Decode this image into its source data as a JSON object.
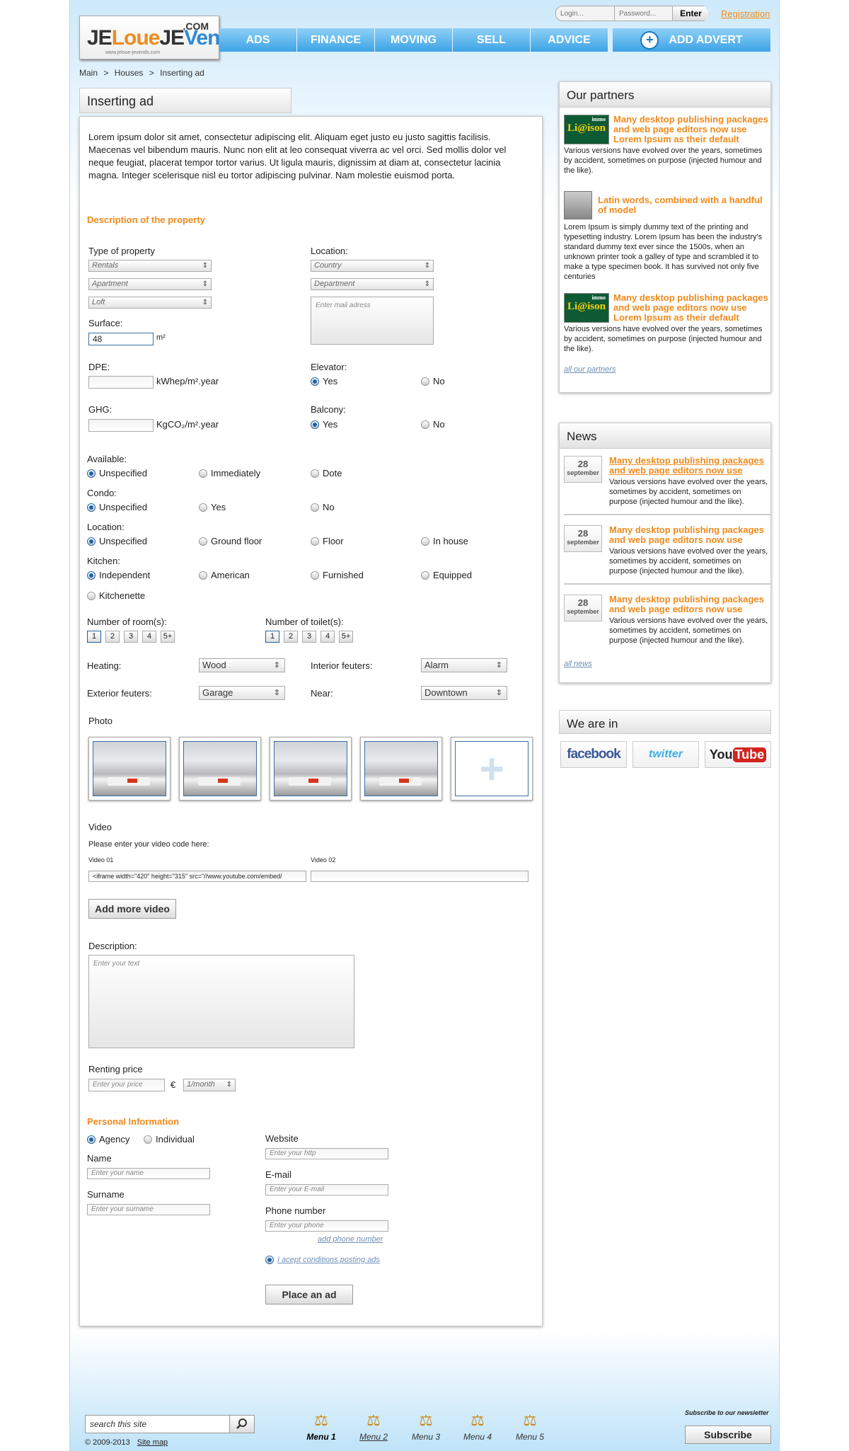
{
  "header": {
    "logo": {
      "part1": "JE",
      "part2": "Loue",
      "part3": "JE",
      "part4": "Vends",
      "com": ".COM",
      "url": "www.jeloue-jevends.com"
    },
    "login_placeholder": "Login...",
    "password_placeholder": "Password...",
    "enter_label": "Enter",
    "registration_label": "Registration",
    "nav": [
      "ADS",
      "FINANCE",
      "MOVING",
      "SELL",
      "ADVICE"
    ],
    "add_advert_label": "ADD ADVERT",
    "breadcrumb": [
      "Main",
      "Houses",
      "Inserting ad"
    ],
    "breadcrumb_sep": ">"
  },
  "main": {
    "title": "Inserting ad",
    "intro": "Lorem ipsum dolor sit amet, consectetur adipiscing elit. Aliquam eget justo eu justo sagittis facilisis. Maecenas vel bibendum mauris. Nunc non elit at leo consequat viverra ac vel orci. Sed mollis dolor vel neque feugiat, placerat tempor tortor varius. Ut ligula mauris, dignissim at diam at, consectetur lacinia magna. Integer scelerisque nisl eu tortor adipiscing pulvinar. Nam molestie euismod porta.",
    "description_title": "Description of the property",
    "type_label": "Type of property",
    "type_selects": [
      "Rentals",
      "Apartment",
      "Loft"
    ],
    "location_label": "Location:",
    "location_selects": [
      "Country",
      "Department"
    ],
    "mail_placeholder": "Enter mail adress",
    "surface_label": "Surface:",
    "surface_value": "48",
    "surface_unit": "m²",
    "dpe_label": "DPE:",
    "dpe_unit": "kWhep/m².year",
    "ghg_label": "GHG:",
    "ghg_unit": "KgCO₂/m².year",
    "elevator_label": "Elevator:",
    "balcony_label": "Balcony:",
    "yes": "Yes",
    "no": "No",
    "available_label": "Available:",
    "available_opts": [
      "Unspecified",
      "Immediately",
      "Dote"
    ],
    "condo_label": "Condo:",
    "condo_opts": [
      "Unspecified",
      "Yes",
      "No"
    ],
    "location2_label": "Location:",
    "location2_opts": [
      "Unspecified",
      "Ground floor",
      "Floor",
      "In house"
    ],
    "kitchen_label": "Kitchen:",
    "kitchen_opts": [
      "Independent",
      "American",
      "Furnished",
      "Equipped",
      "Kitchenette"
    ],
    "rooms_label": "Number of room(s):",
    "toilets_label": "Number of toilet(s):",
    "num_opts": [
      "1",
      "2",
      "3",
      "4",
      "5+"
    ],
    "heating_label": "Heating:",
    "heating_value": "Wood",
    "interior_label": "Interior feuters:",
    "interior_value": "Alarm",
    "exterior_label": "Exterior feuters:",
    "exterior_value": "Garage",
    "near_label": "Near:",
    "near_value": "Downtown",
    "photo_label": "Photo",
    "add_photo_symbol": "+",
    "video_label": "Video",
    "video_hint": "Please enter your video code here:",
    "video1_label": "Video 01",
    "video1_value": "<iframe width=\"420\" height=\"315\" src=\"//www.youtube.com/embed/",
    "video2_label": "Video 02",
    "add_video_label": "Add more video",
    "description_label": "Description:",
    "description_placeholder": "Enter your text",
    "price_label": "Renting price",
    "price_placeholder": "Enter your price",
    "currency": "€",
    "period_value": "1/month",
    "personal_title": "Personal Information",
    "agency": "Agency",
    "individual": "Individual",
    "name_label": "Name",
    "name_placeholder": "Enter your name",
    "surname_label": "Surname",
    "surname_placeholder": "Enter your surname",
    "website_label": "Website",
    "website_placeholder": "Enter your http",
    "email_label": "E-mail",
    "email_placeholder": "Enter your E-mail",
    "phone_label": "Phone number",
    "phone_placeholder": "Enter your phone",
    "add_phone": "add phone number",
    "conditions": "I acept conditions posting ads",
    "place_ad": "Place an ad"
  },
  "sidebar": {
    "partners_title": "Our partners",
    "partners": [
      {
        "title": "Many desktop publishing packages and web page editors now use Lorem Ipsum as their default",
        "text": "Various versions have evolved over the years, sometimes by accident, sometimes on purpose (injected humour and the like).",
        "logo_a": "immo",
        "logo_b": "Li@ison"
      },
      {
        "title": "Latin words, combined with a handful of model",
        "text": "Lorem Ipsum is simply dummy text of the printing and typesetting industry. Lorem Ipsum has been the industry's standard dummy text ever since the 1500s, when an unknown printer took a galley of type and scrambled it to make a type specimen book. It has survived not only five centuries"
      },
      {
        "title": "Many desktop publishing packages and web page editors now use Lorem Ipsum as their default",
        "text": "Various versions have evolved over the years, sometimes by accident, sometimes on purpose (injected humour and the like).",
        "logo_a": "immo",
        "logo_b": "Li@ison"
      }
    ],
    "all_partners": "all our partners",
    "news_title": "News",
    "news": [
      {
        "day": "28",
        "month": "september",
        "title": "Many desktop publishing packages and web page editors now use",
        "text": "Various versions have evolved over the years, sometimes by accident, sometimes on purpose (injected humour and the like)."
      },
      {
        "day": "28",
        "month": "september",
        "title": "Many desktop publishing packages and web page editors now use",
        "text": "Various versions have evolved over the years, sometimes by accident, sometimes on purpose (injected humour and the like)."
      },
      {
        "day": "28",
        "month": "september",
        "title": "Many desktop publishing packages and web page editors now use",
        "text": "Various versions have evolved over the years, sometimes by accident, sometimes on purpose (injected humour and the like)."
      }
    ],
    "all_news": "all news",
    "we_are_in": "We are in",
    "social": {
      "facebook": "facebook",
      "twitter": "twitter",
      "youtube_a": "You",
      "youtube_b": "Tube"
    }
  },
  "footer": {
    "search_value": "search this site",
    "copyright": "© 2009-2013",
    "sitemap": "Site map",
    "menus": [
      "Menu 1",
      "Menu 2",
      "Menu 3",
      "Menu 4",
      "Menu 5"
    ],
    "newsletter": "Subscribe to our newsletter",
    "subscribe": "Subscribe"
  },
  "colors": {
    "accent": "#f08a1c",
    "nav": "#3ca3e6",
    "radio": "#1d62a8"
  }
}
